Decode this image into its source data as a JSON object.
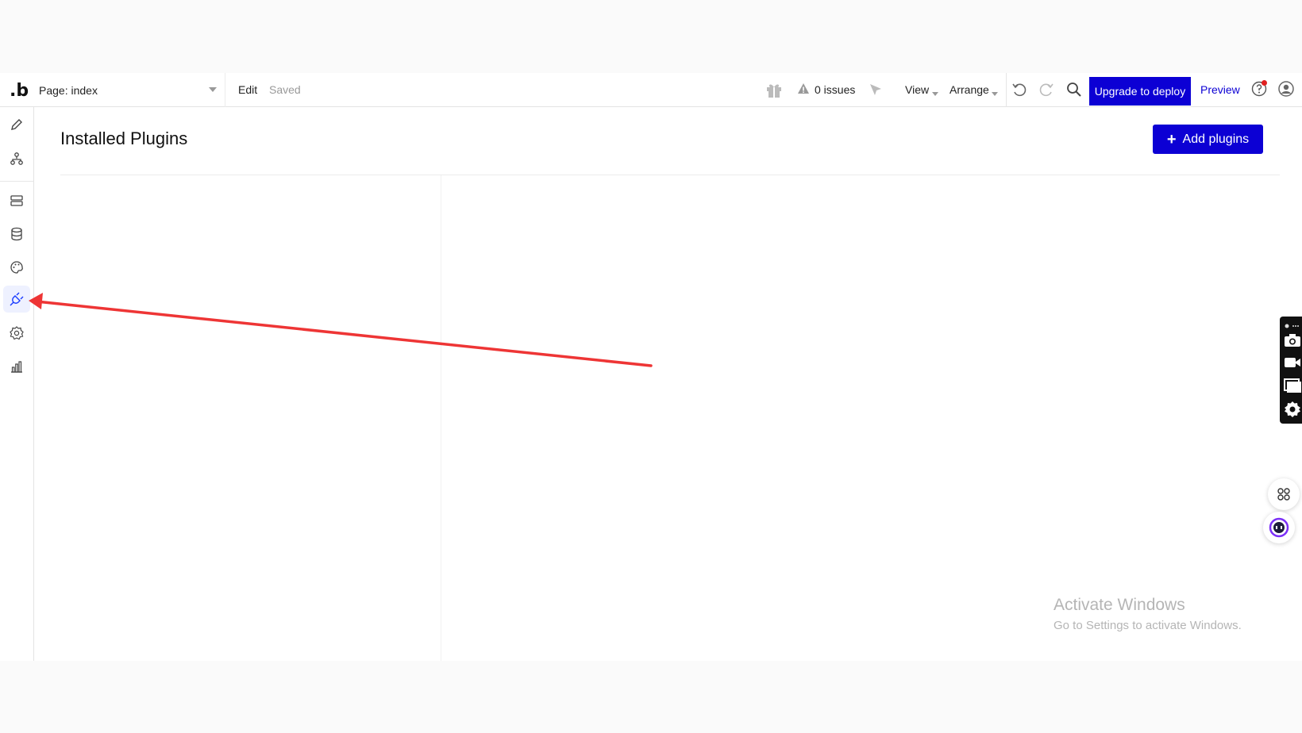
{
  "topbar": {
    "logo": ".b",
    "page_selector": "Page: index",
    "edit": "Edit",
    "saved": "Saved",
    "issues": "0 issues",
    "view": "View",
    "arrange": "Arrange",
    "deploy": "Upgrade to deploy",
    "preview": "Preview"
  },
  "sidebar": {
    "items": [
      {
        "icon": "pencil-icon",
        "label": "design"
      },
      {
        "icon": "workflow-icon",
        "label": "workflow"
      },
      {
        "icon": "server-icon",
        "label": "backend"
      },
      {
        "icon": "database-icon",
        "label": "data"
      },
      {
        "icon": "palette-icon",
        "label": "styles"
      },
      {
        "icon": "plug-icon",
        "label": "plugins",
        "active": true
      },
      {
        "icon": "gear-icon",
        "label": "settings"
      },
      {
        "icon": "bar-chart-icon",
        "label": "logs"
      }
    ]
  },
  "main": {
    "title": "Installed Plugins",
    "add_button": "Add plugins"
  },
  "watermark": {
    "title": "Activate Windows",
    "subtitle": "Go to Settings to activate Windows."
  },
  "colors": {
    "primary": "#0c00d4",
    "arrow": "#ee3535",
    "border": "#e3e3e3"
  }
}
